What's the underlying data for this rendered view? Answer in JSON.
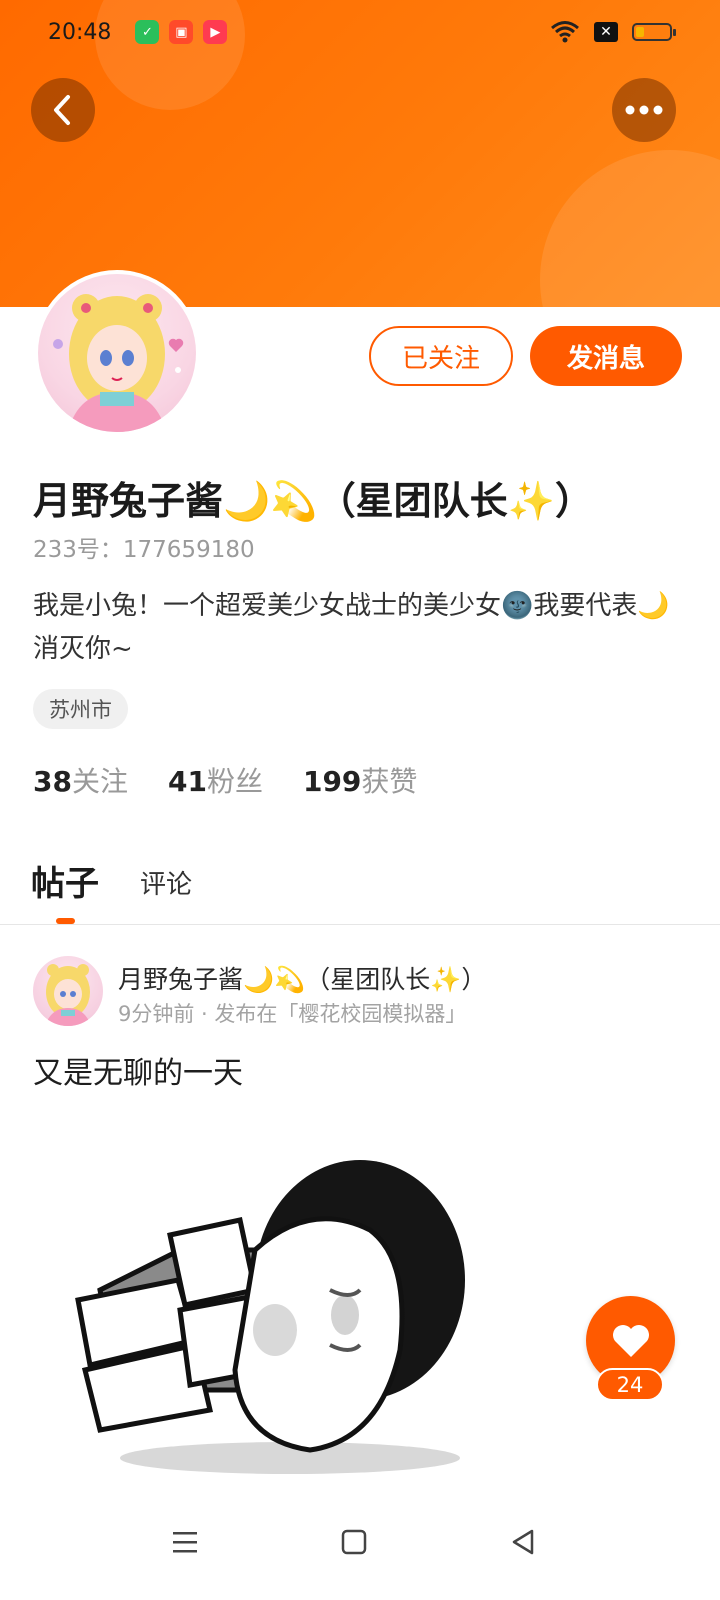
{
  "status_bar": {
    "time": "20:48",
    "app_icons": [
      "wechat-icon",
      "kuaishou-icon",
      "video-app-icon"
    ],
    "battery_level": 0.25
  },
  "header": {
    "back_icon": "chevron-left-icon",
    "more_icon": "more-horizontal-icon",
    "colors": {
      "header_gradient_start": "#ff6a00",
      "header_gradient_end": "#ff8a1a",
      "accent": "#ff5a00"
    }
  },
  "profile": {
    "follow_label": "已关注",
    "message_label": "发消息",
    "nickname": "月野兔子酱🌙💫（星团队长✨）",
    "uid": "233号：177659180",
    "bio": "我是小兔！一个超爱美少女战士的美少女🌚我要代表🌙消灭你~",
    "location": "苏州市",
    "stats": [
      {
        "num": "38",
        "label": "关注"
      },
      {
        "num": "41",
        "label": "粉丝"
      },
      {
        "num": "199",
        "label": "获赞"
      }
    ]
  },
  "tabs": {
    "posts": "帖子",
    "comments": "评论"
  },
  "post": {
    "author": "月野兔子酱🌙💫（星团队长✨）",
    "meta": "9分钟前 · 发布在「樱花校园模拟器」",
    "text": "又是无聊的一天",
    "like_count": "24"
  },
  "navbar": {
    "icons": [
      "menu-icon",
      "home-square-icon",
      "back-triangle-icon"
    ]
  }
}
